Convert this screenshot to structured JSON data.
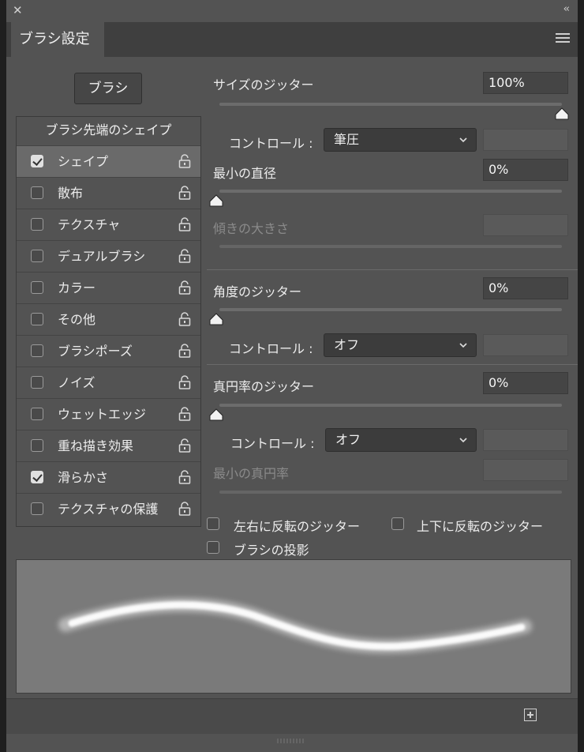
{
  "window": {
    "title_tab": "ブラシ設定"
  },
  "icons": {
    "close": "close-icon",
    "collapse": "double-chevron-icon",
    "menu": "panel-menu-icon",
    "lock": "unlock-icon",
    "new": "new-brush-icon"
  },
  "brush_button": "ブラシ",
  "list": {
    "title": "ブラシ先端のシェイプ",
    "items": [
      {
        "label": "シェイプ",
        "checked": true,
        "selected": true
      },
      {
        "label": "散布",
        "checked": false
      },
      {
        "label": "テクスチャ",
        "checked": false
      },
      {
        "label": "デュアルブラシ",
        "checked": false
      },
      {
        "label": "カラー",
        "checked": false
      },
      {
        "label": "その他",
        "checked": false
      },
      {
        "label": "ブラシポーズ",
        "checked": false
      },
      {
        "label": "ノイズ",
        "checked": false
      },
      {
        "label": "ウェットエッジ",
        "checked": false
      },
      {
        "label": "重ね描き効果",
        "checked": false
      },
      {
        "label": "滑らかさ",
        "checked": true
      },
      {
        "label": "テクスチャの保護",
        "checked": false
      }
    ]
  },
  "settings": {
    "size_jitter": {
      "label": "サイズのジッター",
      "value": "100%",
      "level": 1.0
    },
    "size_control": {
      "label": "コントロール :",
      "value": "筆圧"
    },
    "min_diameter": {
      "label": "最小の直径",
      "value": "0%",
      "level": 0.0
    },
    "tilt_scale": {
      "label": "傾きの大きさ"
    },
    "angle_jitter": {
      "label": "角度のジッター",
      "value": "0%",
      "level": 0.0
    },
    "angle_control": {
      "label": "コントロール :",
      "value": "オフ"
    },
    "roundness_jitter": {
      "label": "真円率のジッター",
      "value": "0%",
      "level": 0.0
    },
    "roundness_control": {
      "label": "コントロール :",
      "value": "オフ"
    },
    "min_roundness": {
      "label": "最小の真円率"
    },
    "flip_x": "左右に反転のジッター",
    "flip_y": "上下に反転のジッター",
    "projection": "ブラシの投影"
  }
}
